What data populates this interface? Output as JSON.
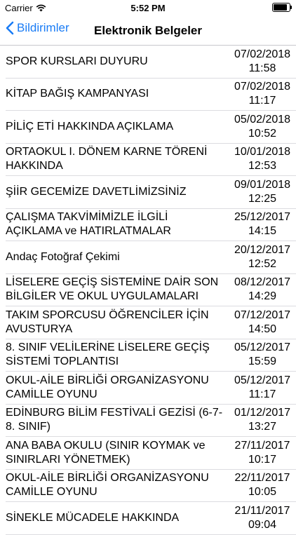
{
  "status": {
    "carrier": "Carrier",
    "time": "5:52 PM",
    "battery_level": 0.95
  },
  "nav": {
    "back_label": "Bildirimler",
    "title": "Elektronik Belgeler"
  },
  "items": [
    {
      "title": "SPOR KURSLARI DUYURU",
      "date": "07/02/2018 11:58"
    },
    {
      "title": "KİTAP BAĞIŞ KAMPANYASI",
      "date": "07/02/2018 11:17"
    },
    {
      "title": "PİLİÇ ETİ HAKKINDA AÇIKLAMA",
      "date": "05/02/2018 10:52"
    },
    {
      "title": "ORTAOKUL I. DÖNEM KARNE TÖRENİ HAKKINDA",
      "date": "10/01/2018 12:53"
    },
    {
      "title": "ŞİİR GECEMİZE DAVETLİMİZSİNİZ",
      "date": "09/01/2018 12:25"
    },
    {
      "title": "ÇALIŞMA TAKVİMİMİZLE İLGİLİ AÇIKLAMA ve HATIRLATMALAR",
      "date": "25/12/2017 14:15"
    },
    {
      "title": "Andaç Fotoğraf Çekimi",
      "date": "20/12/2017 12:52"
    },
    {
      "title": "LİSELERE GEÇİŞ SİSTEMİNE DAİR SON BİLGİLER VE OKUL UYGULAMALARI",
      "date": "08/12/2017 14:29"
    },
    {
      "title": "TAKIM SPORCUSU ÖĞRENCİLER İÇİN AVUSTURYA",
      "date": "07/12/2017 14:50"
    },
    {
      "title": "8. SINIF VELİLERİNE LİSELERE GEÇİŞ SİSTEMİ TOPLANTISI",
      "date": "05/12/2017 15:59"
    },
    {
      "title": "OKUL-AİLE BİRLİĞİ ORGANİZASYONU CAMİLLE OYUNU",
      "date": "05/12/2017 11:17"
    },
    {
      "title": "EDİNBURG BİLİM FESTİVALİ GEZİSİ (6-7-8. SINIF)",
      "date": "01/12/2017 13:27"
    },
    {
      "title": "ANA BABA OKULU (SINIR KOYMAK ve SINIRLARI YÖNETMEK)",
      "date": "27/11/2017 10:17"
    },
    {
      "title": "OKUL-AİLE BİRLİĞİ ORGANİZASYONU CAMİLLE OYUNU",
      "date": "22/11/2017 10:05"
    },
    {
      "title": "SİNEKLE MÜCADELE HAKKINDA",
      "date": "21/11/2017 09:04"
    }
  ]
}
